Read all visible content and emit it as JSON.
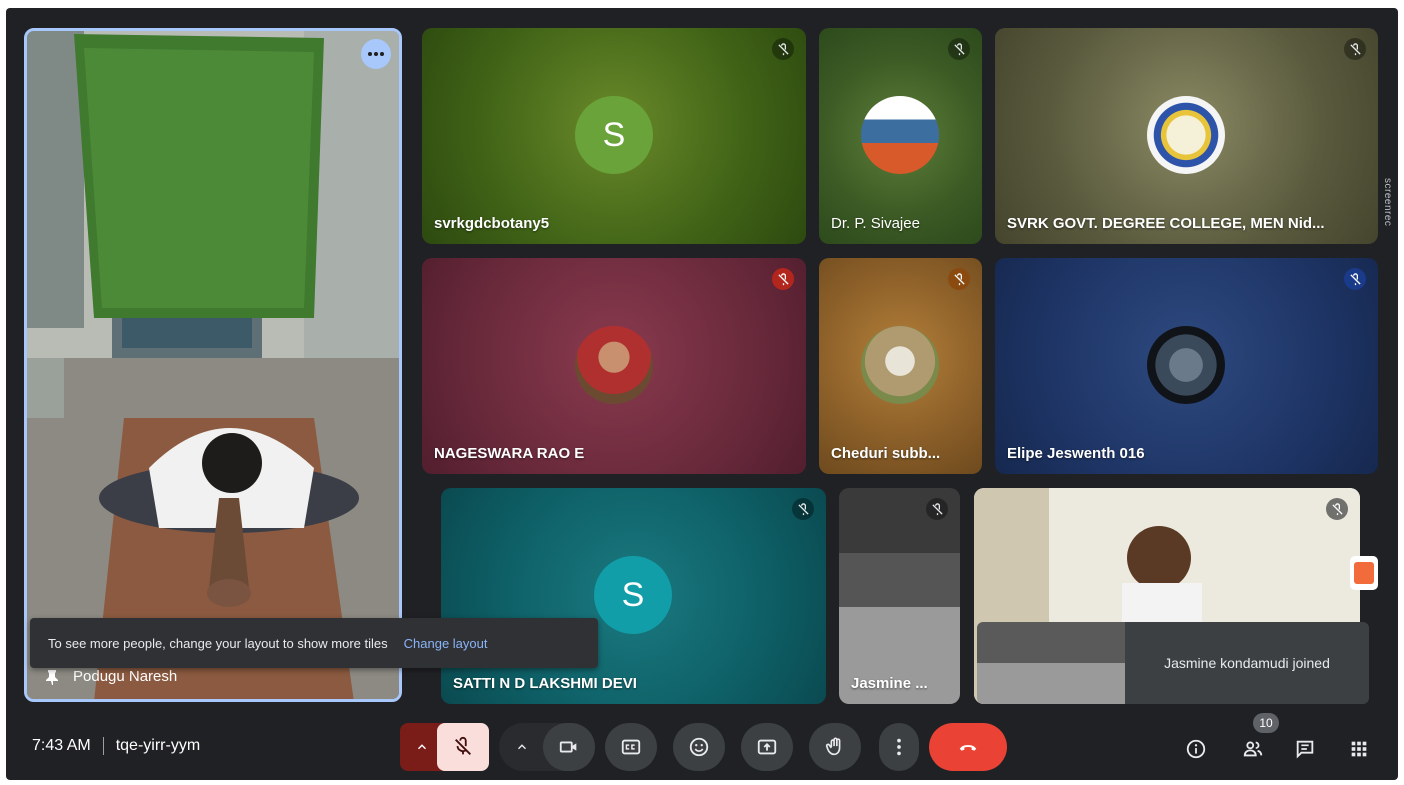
{
  "meeting": {
    "time": "7:43 AM",
    "code": "tqe-yirr-yym"
  },
  "participants": {
    "pinned": "Podugu Naresh",
    "p1": {
      "name": "svrkgdcbotany5",
      "initial": "S"
    },
    "p2": {
      "name": "Dr. P. Sivajee"
    },
    "p3": {
      "name": "SVRK GOVT. DEGREE COLLEGE, MEN Nid..."
    },
    "p4": {
      "name": "NAGESWARA RAO E"
    },
    "p5": {
      "name": "Cheduri subb..."
    },
    "p6": {
      "name": "Elipe Jeswenth 016"
    },
    "p7": {
      "name": "SATTI N D LAKSHMI DEVI",
      "initial": "S"
    },
    "p8": {
      "name": "Jasmine ..."
    }
  },
  "toast": {
    "text": "To see more people, change your layout to show more tiles",
    "action": "Change layout"
  },
  "notification": "Jasmine kondamudi joined",
  "people_count": "10",
  "watermark": "screenrec",
  "colors": {
    "end_call": "#ea4335",
    "accent": "#8ab4f8",
    "muted_bg": "#f9dedc"
  }
}
